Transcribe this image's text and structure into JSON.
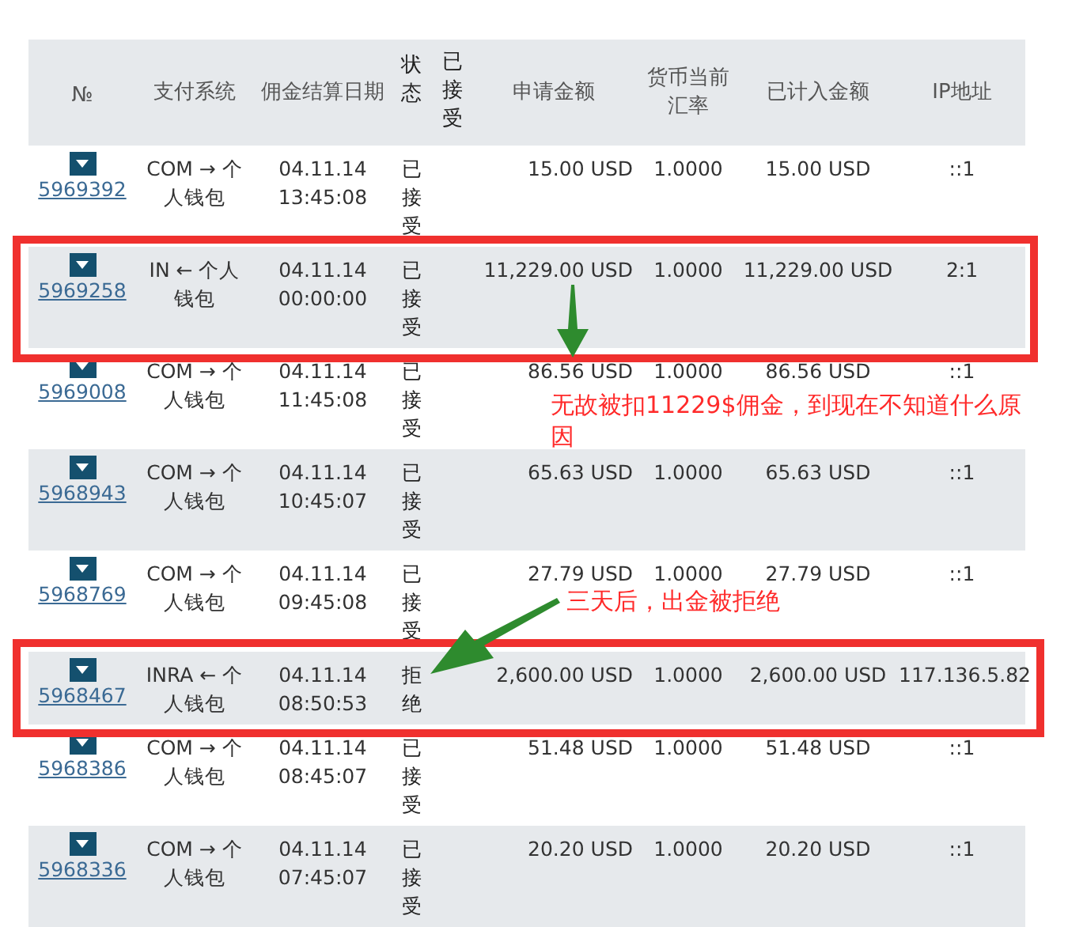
{
  "table": {
    "columns": [
      "№",
      "支付系统",
      "佣金结算日期",
      "状态",
      "已接受",
      "申请金额",
      "货币当前汇率",
      "已计入金额",
      "IP地址"
    ],
    "rows": [
      {
        "id": "5969392",
        "system": "COM → 个人钱包",
        "date": "04.11.14 13:45:08",
        "status": "已接受",
        "requested": "15.00 USD",
        "rate": "1.0000",
        "credited": "15.00 USD",
        "ip": "::1"
      },
      {
        "id": "5969258",
        "system": "IN ← 个人钱包",
        "date": "04.11.14 00:00:00",
        "status": "已接受",
        "requested": "11,229.00 USD",
        "rate": "1.0000",
        "credited": "11,229.00 USD",
        "ip": "2:1"
      },
      {
        "id": "5969008",
        "system": "COM → 个人钱包",
        "date": "04.11.14 11:45:08",
        "status": "已接受",
        "requested": "86.56 USD",
        "rate": "1.0000",
        "credited": "86.56 USD",
        "ip": "::1"
      },
      {
        "id": "5968943",
        "system": "COM → 个人钱包",
        "date": "04.11.14 10:45:07",
        "status": "已接受",
        "requested": "65.63 USD",
        "rate": "1.0000",
        "credited": "65.63 USD",
        "ip": "::1"
      },
      {
        "id": "5968769",
        "system": "COM → 个人钱包",
        "date": "04.11.14 09:45:08",
        "status": "已接受",
        "requested": "27.79 USD",
        "rate": "1.0000",
        "credited": "27.79 USD",
        "ip": "::1"
      },
      {
        "id": "5968467",
        "system": "INRA ← 个人钱包",
        "date": "04.11.14 08:50:53",
        "status": "拒绝",
        "requested": "2,600.00 USD",
        "rate": "1.0000",
        "credited": "2,600.00 USD",
        "ip": "117.136.5.82"
      },
      {
        "id": "5968386",
        "system": "COM → 个人钱包",
        "date": "04.11.14 08:45:07",
        "status": "已接受",
        "requested": "51.48 USD",
        "rate": "1.0000",
        "credited": "51.48 USD",
        "ip": "::1"
      },
      {
        "id": "5968336",
        "system": "COM → 个人钱包",
        "date": "04.11.14 07:45:07",
        "status": "已接受",
        "requested": "20.20 USD",
        "rate": "1.0000",
        "credited": "20.20 USD",
        "ip": "::1"
      }
    ]
  },
  "annotations": [
    {
      "kind": "note",
      "text": "无故被扣11229$佣金，到现在不知道什么原因"
    },
    {
      "kind": "note",
      "text": "三天后，出金被拒绝"
    }
  ]
}
